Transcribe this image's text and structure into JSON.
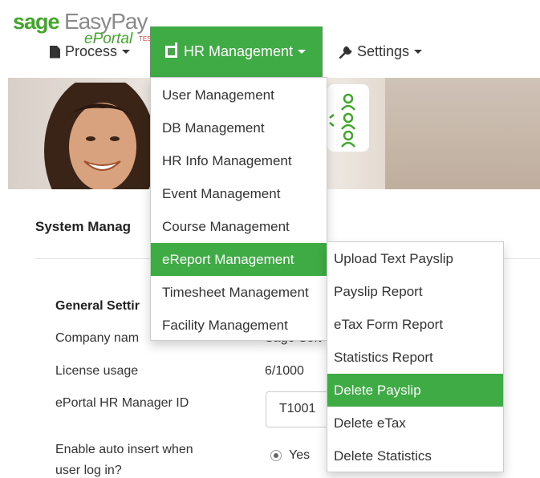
{
  "brand": {
    "sage": "sage",
    "easypay": "EasyPay",
    "eportal": "ePortal",
    "testmark": "TEST"
  },
  "navbar": {
    "process": "Process",
    "hr_management": "HR Management",
    "settings": "Settings"
  },
  "hr_menu": {
    "items": [
      "User Management",
      "DB Management",
      "HR Info Management",
      "Event Management",
      "Course Management",
      "eReport Management",
      "Timesheet Management",
      "Facility Management"
    ],
    "active_index": 5
  },
  "ereport_menu": {
    "items": [
      "Upload Text Payslip",
      "Payslip Report",
      "eTax Form Report",
      "Statistics Report",
      "Delete Payslip",
      "Delete eTax",
      "Delete Statistics"
    ],
    "active_index": 4
  },
  "main": {
    "title": "System Manag",
    "general_title": "General Settir",
    "company_label": "Company nam",
    "company_value": "Sage Soft",
    "license_label": "License usage",
    "license_value": "6/1000",
    "hr_manager_label": "ePortal HR Manager ID",
    "hr_manager_value": "T1001",
    "auto_insert_label_1": "Enable auto insert when",
    "auto_insert_label_2": "user log in?",
    "auto_insert_option": "Yes"
  },
  "colors": {
    "accent": "#3fab45",
    "brand_green": "#41a62a"
  }
}
